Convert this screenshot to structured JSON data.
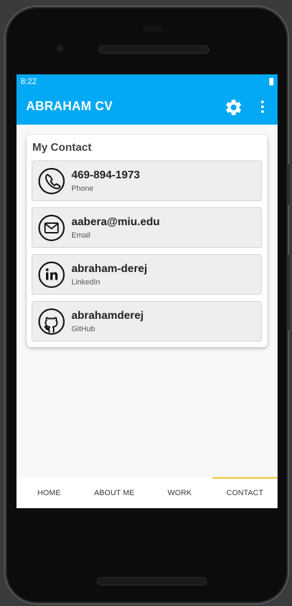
{
  "status_bar": {
    "time": "8:22"
  },
  "app_bar": {
    "title": "ABRAHAM CV",
    "settings_icon": "gear-icon",
    "menu_icon": "more-vert-icon"
  },
  "contact_card": {
    "title": "My Contact",
    "items": [
      {
        "value": "469-894-1973",
        "type": "Phone",
        "icon": "phone-icon"
      },
      {
        "value": "aabera@miu.edu",
        "type": "Email",
        "icon": "email-icon"
      },
      {
        "value": "abraham-derej",
        "type": "LinkedIn",
        "icon": "linkedin-icon"
      },
      {
        "value": "abrahamderej",
        "type": "GitHub",
        "icon": "github-icon"
      }
    ]
  },
  "bottom_nav": {
    "tabs": [
      {
        "label": "HOME"
      },
      {
        "label": "ABOUT ME"
      },
      {
        "label": "WORK"
      },
      {
        "label": "CONTACT"
      }
    ],
    "selected": "CONTACT",
    "indicator_color": "#f9c02a"
  },
  "colors": {
    "primary": "#03a9f4",
    "accent": "#f9c02a"
  }
}
